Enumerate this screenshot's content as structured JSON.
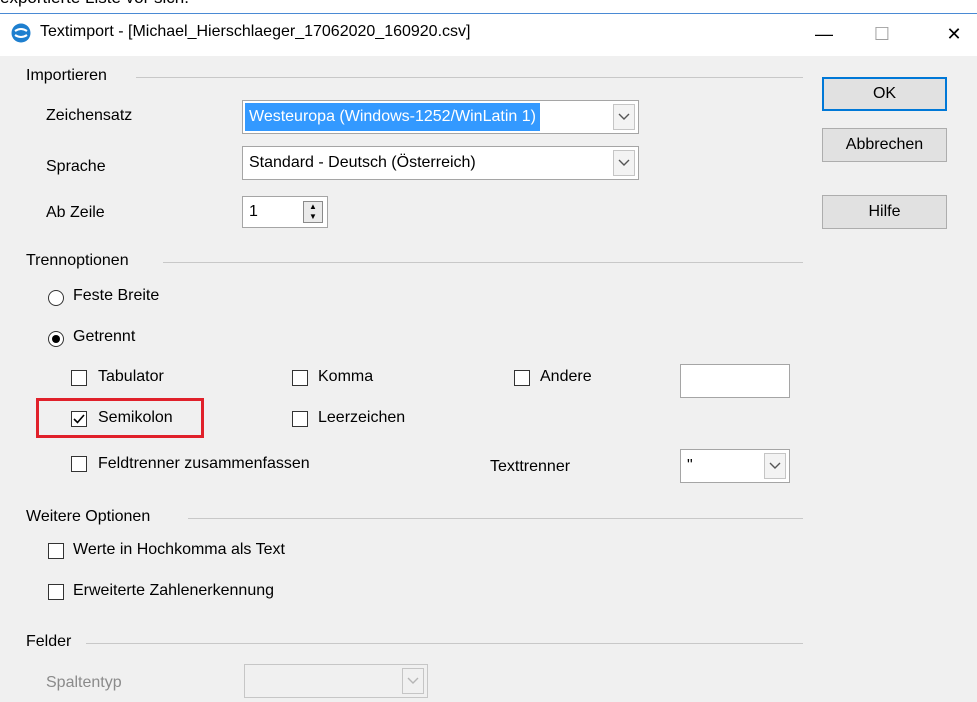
{
  "top_cut_text": "exportierte Liste vor sich.",
  "window": {
    "title": "Textimport - [Michael_Hierschlaeger_17062020_160920.csv]",
    "minimize_glyph": "—",
    "maximize_glyph": "☐",
    "close_glyph": "✕"
  },
  "importieren": {
    "group_label": "Importieren",
    "zeichensatz_label": "Zeichensatz",
    "zeichensatz_value": "Westeuropa (Windows-1252/WinLatin 1)",
    "sprache_label": "Sprache",
    "sprache_value": "Standard - Deutsch (Österreich)",
    "ab_zeile_label": "Ab Zeile",
    "ab_zeile_value": "1"
  },
  "trennoptionen": {
    "group_label": "Trennoptionen",
    "feste_breite": "Feste Breite",
    "getrennt": "Getrennt",
    "tabulator": "Tabulator",
    "komma": "Komma",
    "andere": "Andere",
    "semikolon": "Semikolon",
    "leerzeichen": "Leerzeichen",
    "feldtrenner": "Feldtrenner zusammenfassen",
    "texttrenner_label": "Texttrenner",
    "texttrenner_value": "\""
  },
  "weitere": {
    "group_label": "Weitere Optionen",
    "hochkomma": "Werte in Hochkomma als Text",
    "zahlenerkennung": "Erweiterte Zahlenerkennung"
  },
  "felder": {
    "group_label": "Felder",
    "spaltentyp_label": "Spaltentyp"
  },
  "buttons": {
    "ok": "OK",
    "abbrechen": "Abbrechen",
    "hilfe": "Hilfe"
  },
  "icons": {
    "dropdown_arrow": "chevron-down-icon",
    "checkmark": "✓"
  },
  "colors": {
    "selection": "#3399ff",
    "highlight_box": "#e0202a",
    "default_button_border": "#0078d7"
  }
}
